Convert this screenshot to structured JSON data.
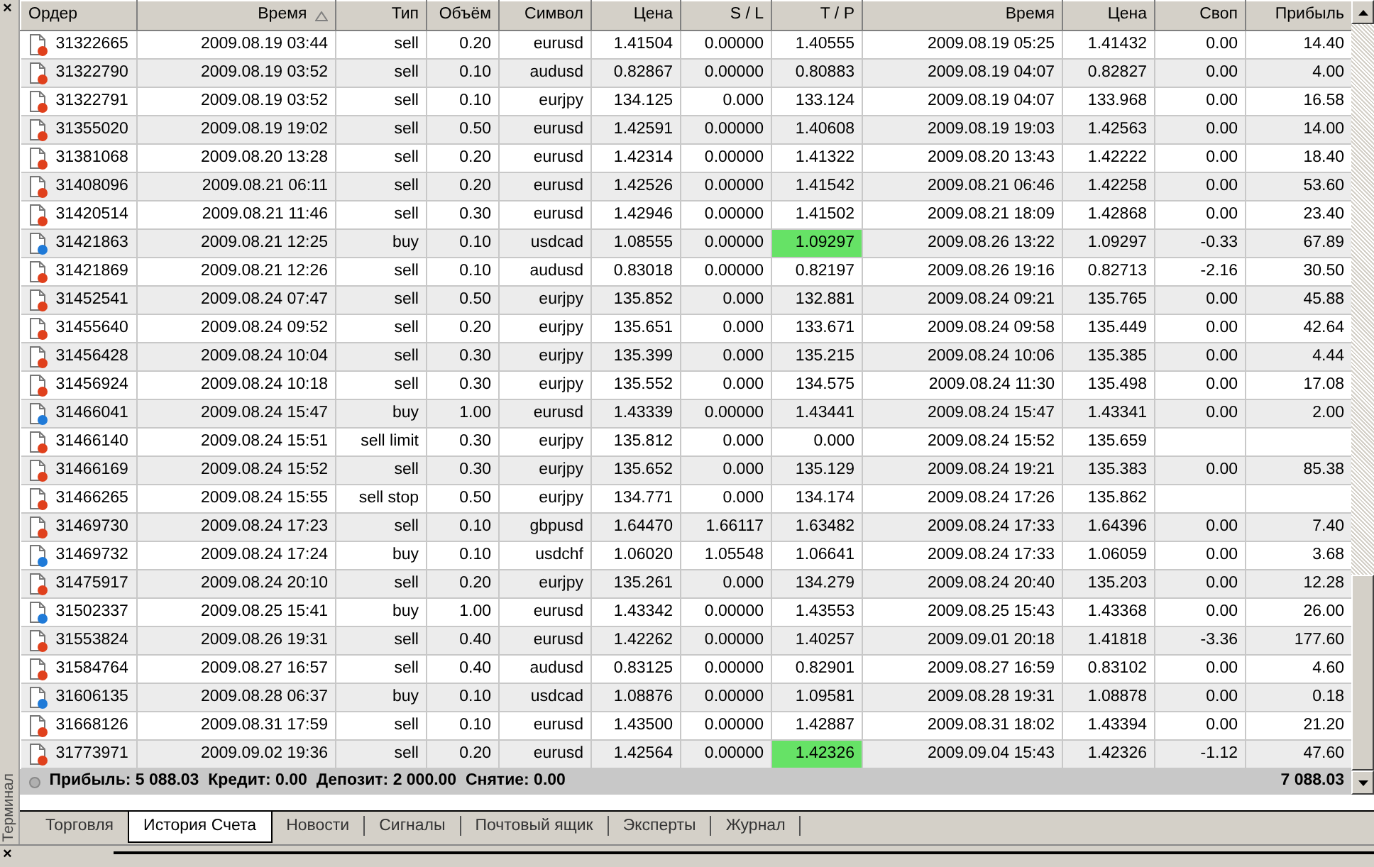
{
  "panel": {
    "close_label": "×",
    "title": "Терминал"
  },
  "columns": [
    {
      "label": "Ордер",
      "sorted": false
    },
    {
      "label": "Время",
      "sorted": true
    },
    {
      "label": "Тип",
      "sorted": false
    },
    {
      "label": "Объём",
      "sorted": false
    },
    {
      "label": "Символ",
      "sorted": false
    },
    {
      "label": "Цена",
      "sorted": false
    },
    {
      "label": "S / L",
      "sorted": false
    },
    {
      "label": "T / P",
      "sorted": false
    },
    {
      "label": "Время",
      "sorted": false
    },
    {
      "label": "Цена",
      "sorted": false
    },
    {
      "label": "Своп",
      "sorted": false
    },
    {
      "label": "Прибыль",
      "sorted": false
    }
  ],
  "rows": [
    {
      "kind": "sell",
      "order": "31322665",
      "open_time": "2009.08.19 03:44",
      "type": "sell",
      "volume": "0.20",
      "symbol": "eurusd",
      "price": "1.41504",
      "sl": "0.00000",
      "tp": "1.40555",
      "tp_hit": false,
      "close_time": "2009.08.19 05:25",
      "close_price": "1.41432",
      "swap": "0.00",
      "profit": "14.40"
    },
    {
      "kind": "sell",
      "order": "31322790",
      "open_time": "2009.08.19 03:52",
      "type": "sell",
      "volume": "0.10",
      "symbol": "audusd",
      "price": "0.82867",
      "sl": "0.00000",
      "tp": "0.80883",
      "tp_hit": false,
      "close_time": "2009.08.19 04:07",
      "close_price": "0.82827",
      "swap": "0.00",
      "profit": "4.00"
    },
    {
      "kind": "sell",
      "order": "31322791",
      "open_time": "2009.08.19 03:52",
      "type": "sell",
      "volume": "0.10",
      "symbol": "eurjpy",
      "price": "134.125",
      "sl": "0.000",
      "tp": "133.124",
      "tp_hit": false,
      "close_time": "2009.08.19 04:07",
      "close_price": "133.968",
      "swap": "0.00",
      "profit": "16.58"
    },
    {
      "kind": "sell",
      "order": "31355020",
      "open_time": "2009.08.19 19:02",
      "type": "sell",
      "volume": "0.50",
      "symbol": "eurusd",
      "price": "1.42591",
      "sl": "0.00000",
      "tp": "1.40608",
      "tp_hit": false,
      "close_time": "2009.08.19 19:03",
      "close_price": "1.42563",
      "swap": "0.00",
      "profit": "14.00"
    },
    {
      "kind": "sell",
      "order": "31381068",
      "open_time": "2009.08.20 13:28",
      "type": "sell",
      "volume": "0.20",
      "symbol": "eurusd",
      "price": "1.42314",
      "sl": "0.00000",
      "tp": "1.41322",
      "tp_hit": false,
      "close_time": "2009.08.20 13:43",
      "close_price": "1.42222",
      "swap": "0.00",
      "profit": "18.40"
    },
    {
      "kind": "sell",
      "order": "31408096",
      "open_time": "2009.08.21 06:11",
      "type": "sell",
      "volume": "0.20",
      "symbol": "eurusd",
      "price": "1.42526",
      "sl": "0.00000",
      "tp": "1.41542",
      "tp_hit": false,
      "close_time": "2009.08.21 06:46",
      "close_price": "1.42258",
      "swap": "0.00",
      "profit": "53.60"
    },
    {
      "kind": "sell",
      "order": "31420514",
      "open_time": "2009.08.21 11:46",
      "type": "sell",
      "volume": "0.30",
      "symbol": "eurusd",
      "price": "1.42946",
      "sl": "0.00000",
      "tp": "1.41502",
      "tp_hit": false,
      "close_time": "2009.08.21 18:09",
      "close_price": "1.42868",
      "swap": "0.00",
      "profit": "23.40"
    },
    {
      "kind": "buy",
      "order": "31421863",
      "open_time": "2009.08.21 12:25",
      "type": "buy",
      "volume": "0.10",
      "symbol": "usdcad",
      "price": "1.08555",
      "sl": "0.00000",
      "tp": "1.09297",
      "tp_hit": true,
      "close_time": "2009.08.26 13:22",
      "close_price": "1.09297",
      "swap": "-0.33",
      "profit": "67.89"
    },
    {
      "kind": "sell",
      "order": "31421869",
      "open_time": "2009.08.21 12:26",
      "type": "sell",
      "volume": "0.10",
      "symbol": "audusd",
      "price": "0.83018",
      "sl": "0.00000",
      "tp": "0.82197",
      "tp_hit": false,
      "close_time": "2009.08.26 19:16",
      "close_price": "0.82713",
      "swap": "-2.16",
      "profit": "30.50"
    },
    {
      "kind": "sell",
      "order": "31452541",
      "open_time": "2009.08.24 07:47",
      "type": "sell",
      "volume": "0.50",
      "symbol": "eurjpy",
      "price": "135.852",
      "sl": "0.000",
      "tp": "132.881",
      "tp_hit": false,
      "close_time": "2009.08.24 09:21",
      "close_price": "135.765",
      "swap": "0.00",
      "profit": "45.88"
    },
    {
      "kind": "sell",
      "order": "31455640",
      "open_time": "2009.08.24 09:52",
      "type": "sell",
      "volume": "0.20",
      "symbol": "eurjpy",
      "price": "135.651",
      "sl": "0.000",
      "tp": "133.671",
      "tp_hit": false,
      "close_time": "2009.08.24 09:58",
      "close_price": "135.449",
      "swap": "0.00",
      "profit": "42.64"
    },
    {
      "kind": "sell",
      "order": "31456428",
      "open_time": "2009.08.24 10:04",
      "type": "sell",
      "volume": "0.30",
      "symbol": "eurjpy",
      "price": "135.399",
      "sl": "0.000",
      "tp": "135.215",
      "tp_hit": false,
      "close_time": "2009.08.24 10:06",
      "close_price": "135.385",
      "swap": "0.00",
      "profit": "4.44"
    },
    {
      "kind": "sell",
      "order": "31456924",
      "open_time": "2009.08.24 10:18",
      "type": "sell",
      "volume": "0.30",
      "symbol": "eurjpy",
      "price": "135.552",
      "sl": "0.000",
      "tp": "134.575",
      "tp_hit": false,
      "close_time": "2009.08.24 11:30",
      "close_price": "135.498",
      "swap": "0.00",
      "profit": "17.08"
    },
    {
      "kind": "buy",
      "order": "31466041",
      "open_time": "2009.08.24 15:47",
      "type": "buy",
      "volume": "1.00",
      "symbol": "eurusd",
      "price": "1.43339",
      "sl": "0.00000",
      "tp": "1.43441",
      "tp_hit": false,
      "close_time": "2009.08.24 15:47",
      "close_price": "1.43341",
      "swap": "0.00",
      "profit": "2.00"
    },
    {
      "kind": "sell",
      "order": "31466140",
      "open_time": "2009.08.24 15:51",
      "type": "sell limit",
      "volume": "0.30",
      "symbol": "eurjpy",
      "price": "135.812",
      "sl": "0.000",
      "tp": "0.000",
      "tp_hit": false,
      "close_time": "2009.08.24 15:52",
      "close_price": "135.659"
    },
    {
      "kind": "sell",
      "order": "31466169",
      "open_time": "2009.08.24 15:52",
      "type": "sell",
      "volume": "0.30",
      "symbol": "eurjpy",
      "price": "135.652",
      "sl": "0.000",
      "tp": "135.129",
      "tp_hit": false,
      "close_time": "2009.08.24 19:21",
      "close_price": "135.383",
      "swap": "0.00",
      "profit": "85.38"
    },
    {
      "kind": "sell",
      "order": "31466265",
      "open_time": "2009.08.24 15:55",
      "type": "sell stop",
      "volume": "0.50",
      "symbol": "eurjpy",
      "price": "134.771",
      "sl": "0.000",
      "tp": "134.174",
      "tp_hit": false,
      "close_time": "2009.08.24 17:26",
      "close_price": "135.862"
    },
    {
      "kind": "sell",
      "order": "31469730",
      "open_time": "2009.08.24 17:23",
      "type": "sell",
      "volume": "0.10",
      "symbol": "gbpusd",
      "price": "1.64470",
      "sl": "1.66117",
      "tp": "1.63482",
      "tp_hit": false,
      "close_time": "2009.08.24 17:33",
      "close_price": "1.64396",
      "swap": "0.00",
      "profit": "7.40"
    },
    {
      "kind": "buy",
      "order": "31469732",
      "open_time": "2009.08.24 17:24",
      "type": "buy",
      "volume": "0.10",
      "symbol": "usdchf",
      "price": "1.06020",
      "sl": "1.05548",
      "tp": "1.06641",
      "tp_hit": false,
      "close_time": "2009.08.24 17:33",
      "close_price": "1.06059",
      "swap": "0.00",
      "profit": "3.68"
    },
    {
      "kind": "sell",
      "order": "31475917",
      "open_time": "2009.08.24 20:10",
      "type": "sell",
      "volume": "0.20",
      "symbol": "eurjpy",
      "price": "135.261",
      "sl": "0.000",
      "tp": "134.279",
      "tp_hit": false,
      "close_time": "2009.08.24 20:40",
      "close_price": "135.203",
      "swap": "0.00",
      "profit": "12.28"
    },
    {
      "kind": "buy",
      "order": "31502337",
      "open_time": "2009.08.25 15:41",
      "type": "buy",
      "volume": "1.00",
      "symbol": "eurusd",
      "price": "1.43342",
      "sl": "0.00000",
      "tp": "1.43553",
      "tp_hit": false,
      "close_time": "2009.08.25 15:43",
      "close_price": "1.43368",
      "swap": "0.00",
      "profit": "26.00"
    },
    {
      "kind": "sell",
      "order": "31553824",
      "open_time": "2009.08.26 19:31",
      "type": "sell",
      "volume": "0.40",
      "symbol": "eurusd",
      "price": "1.42262",
      "sl": "0.00000",
      "tp": "1.40257",
      "tp_hit": false,
      "close_time": "2009.09.01 20:18",
      "close_price": "1.41818",
      "swap": "-3.36",
      "profit": "177.60"
    },
    {
      "kind": "sell",
      "order": "31584764",
      "open_time": "2009.08.27 16:57",
      "type": "sell",
      "volume": "0.40",
      "symbol": "audusd",
      "price": "0.83125",
      "sl": "0.00000",
      "tp": "0.82901",
      "tp_hit": false,
      "close_time": "2009.08.27 16:59",
      "close_price": "0.83102",
      "swap": "0.00",
      "profit": "4.60"
    },
    {
      "kind": "buy",
      "order": "31606135",
      "open_time": "2009.08.28 06:37",
      "type": "buy",
      "volume": "0.10",
      "symbol": "usdcad",
      "price": "1.08876",
      "sl": "0.00000",
      "tp": "1.09581",
      "tp_hit": false,
      "close_time": "2009.08.28 19:31",
      "close_price": "1.08878",
      "swap": "0.00",
      "profit": "0.18"
    },
    {
      "kind": "sell",
      "order": "31668126",
      "open_time": "2009.08.31 17:59",
      "type": "sell",
      "volume": "0.10",
      "symbol": "eurusd",
      "price": "1.43500",
      "sl": "0.00000",
      "tp": "1.42887",
      "tp_hit": false,
      "close_time": "2009.08.31 18:02",
      "close_price": "1.43394",
      "swap": "0.00",
      "profit": "21.20"
    },
    {
      "kind": "sell",
      "order": "31773971",
      "open_time": "2009.09.02 19:36",
      "type": "sell",
      "volume": "0.20",
      "symbol": "eurusd",
      "price": "1.42564",
      "sl": "0.00000",
      "tp": "1.42326",
      "tp_hit": true,
      "close_time": "2009.09.04 15:43",
      "close_price": "1.42326",
      "swap": "-1.12",
      "profit": "47.60"
    }
  ],
  "summary": {
    "text": "Прибыль: 5 088.03  Кредит: 0.00  Депозит: 2 000.00  Снятие: 0.00",
    "total": "7 088.03"
  },
  "tabs": [
    {
      "label": "Торговля",
      "selected": false
    },
    {
      "label": "История Счета",
      "selected": true
    },
    {
      "label": "Новости",
      "selected": false
    },
    {
      "label": "Сигналы",
      "selected": false
    },
    {
      "label": "Почтовый ящик",
      "selected": false
    },
    {
      "label": "Эксперты",
      "selected": false
    },
    {
      "label": "Журнал",
      "selected": false
    }
  ],
  "bottom_panel": {
    "close_label": "×"
  }
}
